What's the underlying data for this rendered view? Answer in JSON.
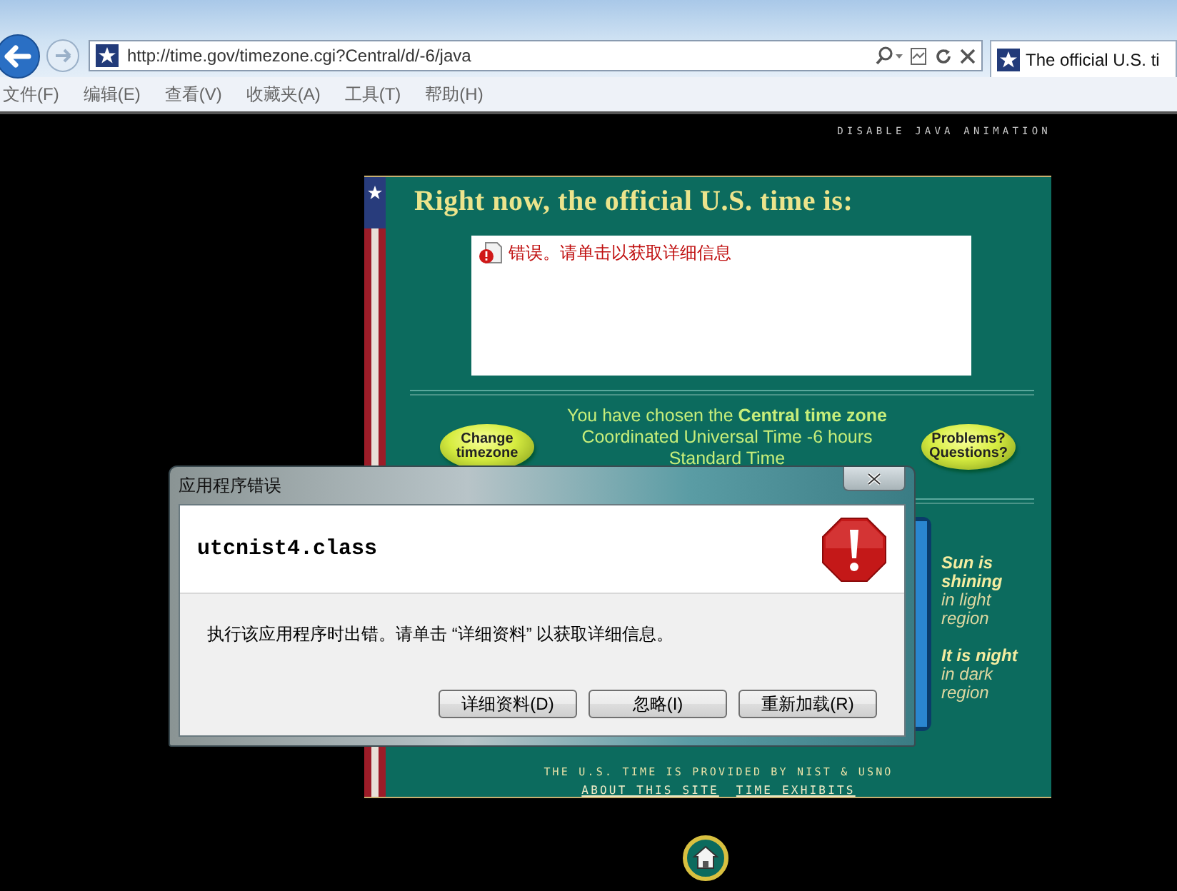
{
  "browser": {
    "url": "http://time.gov/timezone.cgi?Central/d/-6/java",
    "tab_title": "The official U.S. ti",
    "menu": [
      "文件(F)",
      "编辑(E)",
      "查看(V)",
      "收藏夹(A)",
      "工具(T)",
      "帮助(H)"
    ]
  },
  "page": {
    "disable_link": "DISABLE JAVA ANIMATION",
    "heading": "Right now, the official U.S. time is:",
    "applet_error": "错误。请单击以获取详细信息",
    "change_button": "Change timezone",
    "timezone_lines": [
      "You have chosen the **Central time zone**",
      "Coordinated Universal Time -6 hours",
      "Standard Time"
    ],
    "problems_button": "Problems? Questions?",
    "legend": [
      {
        "heading": "Sun is shining",
        "detail": "in light region"
      },
      {
        "heading": "It is night",
        "detail": "in dark region"
      }
    ],
    "credit": "THE U.S. TIME IS PROVIDED BY NIST & USNO",
    "footer_links": [
      "ABOUT THIS SITE",
      "TIME EXHIBITS"
    ]
  },
  "dialog": {
    "title": "应用程序错误",
    "subject": "utcnist4.class",
    "message": "执行该应用程序时出错。请单击 “详细资料” 以获取详细信息。",
    "buttons": [
      "详细资料(D)",
      "忽略(I)",
      "重新加载(R)"
    ]
  }
}
